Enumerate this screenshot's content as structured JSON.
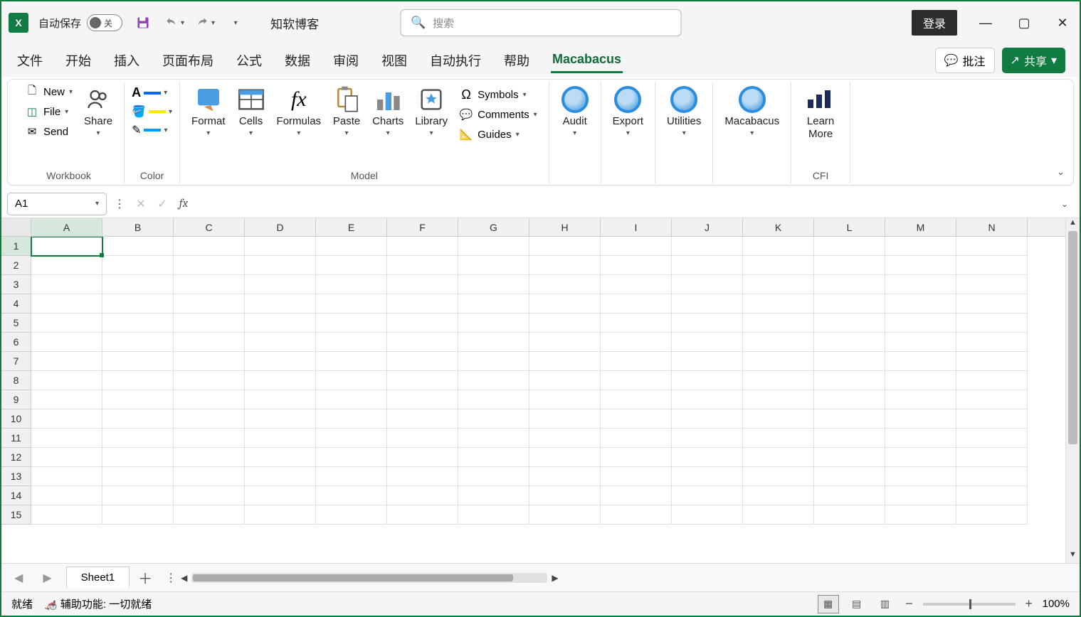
{
  "titlebar": {
    "autosave_label": "自动保存",
    "autosave_state": "关",
    "doc_title": "知软博客",
    "search_placeholder": "搜索",
    "login": "登录"
  },
  "tabs": {
    "items": [
      "文件",
      "开始",
      "插入",
      "页面布局",
      "公式",
      "数据",
      "审阅",
      "视图",
      "自动执行",
      "帮助",
      "Macabacus"
    ],
    "active_index": 10,
    "comment_btn": "批注",
    "share_btn": "共享"
  },
  "ribbon": {
    "workbook": {
      "new": "New",
      "file": "File",
      "send": "Send",
      "share": "Share",
      "label": "Workbook"
    },
    "color": {
      "label": "Color"
    },
    "model": {
      "format": "Format",
      "cells": "Cells",
      "formulas": "Formulas",
      "paste": "Paste",
      "charts": "Charts",
      "library": "Library",
      "symbols": "Symbols",
      "comments": "Comments",
      "guides": "Guides",
      "label": "Model"
    },
    "tools": {
      "audit": "Audit",
      "export": "Export",
      "utilities": "Utilities",
      "macabacus": "Macabacus"
    },
    "cfi": {
      "learn_more": "Learn More",
      "label": "CFI"
    }
  },
  "formula_bar": {
    "name_box": "A1",
    "formula": ""
  },
  "grid": {
    "columns": [
      "A",
      "B",
      "C",
      "D",
      "E",
      "F",
      "G",
      "H",
      "I",
      "J",
      "K",
      "L",
      "M",
      "N"
    ],
    "rows": [
      1,
      2,
      3,
      4,
      5,
      6,
      7,
      8,
      9,
      10,
      11,
      12,
      13,
      14,
      15
    ],
    "selected_cell": "A1"
  },
  "sheets": {
    "active": "Sheet1"
  },
  "statusbar": {
    "ready": "就绪",
    "accessibility": "辅助功能: 一切就绪",
    "zoom": "100%"
  }
}
